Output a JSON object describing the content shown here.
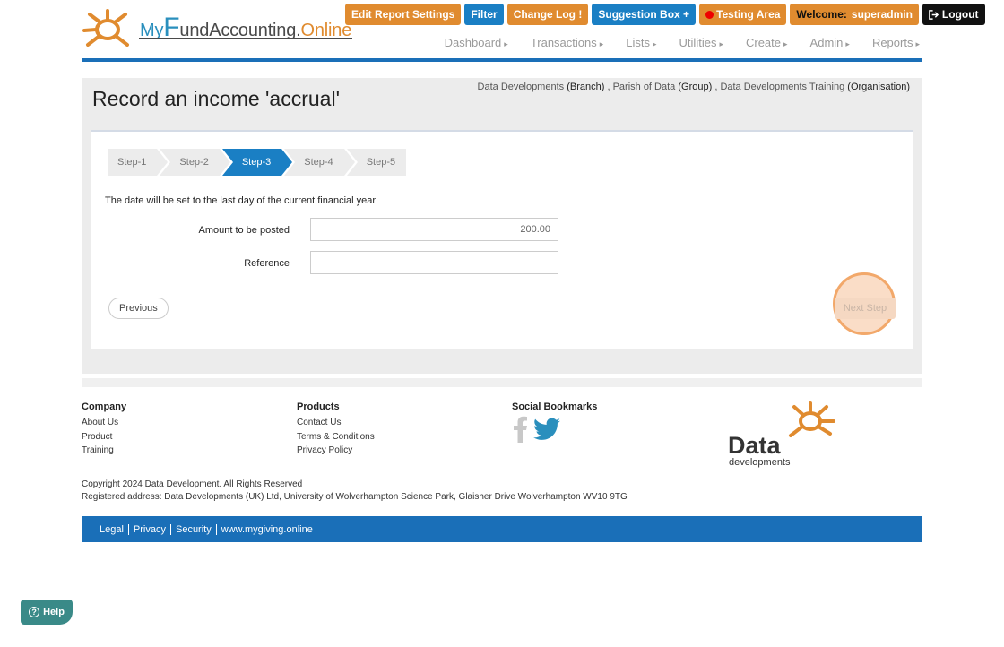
{
  "brand": {
    "my": "My",
    "f": "F",
    "fund": "und",
    "accounting": "Accounting",
    "dot": ".",
    "online": "Online"
  },
  "topbar": {
    "edit_report_settings": "Edit Report Settings",
    "filter": "Filter",
    "change_log": "Change Log",
    "change_log_mark": "!",
    "suggestion_box": "Suggestion Box",
    "suggestion_mark": "+",
    "testing_area": "Testing Area",
    "welcome_label": "Welcome:",
    "username": "superadmin",
    "logout": "Logout"
  },
  "nav": [
    "Dashboard",
    "Transactions",
    "Lists",
    "Utilities",
    "Create",
    "Admin",
    "Reports"
  ],
  "page": {
    "title": "Record an income 'accrual'",
    "breadcrumb": {
      "branch_name": "Data Developments",
      "branch_type": "(Branch)",
      "sep1": ",",
      "group_name": "Parish of Data",
      "group_type": "(Group)",
      "sep2": ",",
      "org_name": "Data Developments Training",
      "org_type": "(Organisation)"
    }
  },
  "wizard": {
    "steps": [
      "Step-1",
      "Step-2",
      "Step-3",
      "Step-4",
      "Step-5"
    ],
    "active_step": 3,
    "note": "The date will be set to the last day of the current financial year",
    "amount_label": "Amount to be posted",
    "amount_value": "200.00",
    "reference_label": "Reference",
    "reference_value": "",
    "previous": "Previous",
    "next": "Next Step"
  },
  "footer": {
    "company_heading": "Company",
    "company_links": [
      "About Us",
      "Product",
      "Training"
    ],
    "products_heading": "Products",
    "products_links": [
      "Contact Us",
      "Terms & Conditions",
      "Privacy Policy"
    ],
    "social_heading": "Social Bookmarks",
    "logo_word": "Data",
    "logo_sub": "developments",
    "copyright": "Copyright 2024 Data Development. All Rights Reserved",
    "address": "Registered address: Data Developments (UK) Ltd, University of Wolverhampton Science Park, Glaisher Drive Wolverhampton WV10 9TG",
    "bottom_links": [
      "Legal",
      "Privacy",
      "Security",
      "www.mygiving.online"
    ]
  },
  "help": "Help",
  "colors": {
    "primary_blue": "#1a7fc4",
    "accent_orange": "#e08b2f",
    "highlight": "#f2a86a"
  }
}
